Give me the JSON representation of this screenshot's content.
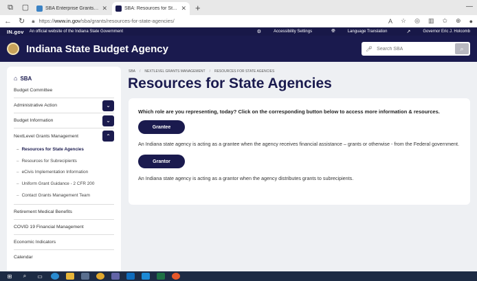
{
  "browser": {
    "tabs": [
      {
        "label": "SBA Enterprise Grants Managem",
        "active": false,
        "color": "#3b82c4"
      },
      {
        "label": "SBA: Resources for State Agencie",
        "active": true,
        "color": "#1a1a4e"
      }
    ],
    "url_prefix": "https://",
    "url_domain": "www.in.gov",
    "url_path": "/sba/grants/resources-for-state-agencies/"
  },
  "ingov": {
    "logo": "IN.gov",
    "official_text": "An official website of the Indiana State Government",
    "accessibility": "Accessibility Settings",
    "translation": "Language Translation",
    "governor": "Governor Eric J. Holcomb"
  },
  "header": {
    "title": "Indiana State Budget Agency",
    "search_placeholder": "Search SBA"
  },
  "sidebar": {
    "home": "SBA",
    "items": [
      {
        "label": "Budget Committee",
        "toggle": ""
      },
      {
        "label": "Administrative Action",
        "toggle": "⌄"
      },
      {
        "label": "Budget Information",
        "toggle": "⌄"
      },
      {
        "label": "NextLevel Grants Management",
        "toggle": "⌃"
      }
    ],
    "subitems": [
      {
        "label": "Resources for State Agencies",
        "active": true
      },
      {
        "label": "Resources for Subrecipients",
        "active": false
      },
      {
        "label": "eCivis Implementation Information",
        "active": false
      },
      {
        "label": "Uniform Grant Guidance - 2 CFR 200",
        "active": false
      },
      {
        "label": "Contact Grants Management Team",
        "active": false
      }
    ],
    "items_after": [
      {
        "label": "Retirement Medical Benefits"
      },
      {
        "label": "COVID 19 Financial Management"
      },
      {
        "label": "Economic Indicators"
      },
      {
        "label": "Calendar"
      }
    ]
  },
  "breadcrumb": [
    "SBA",
    "NEXTLEVEL GRANTS MANAGEMENT",
    "RESOURCES FOR STATE AGENCIES"
  ],
  "main": {
    "title": "Resources for State Agencies",
    "question": "Which role are you representing, today? Click on the corresponding button below to access more information & resources.",
    "grantee_label": "Grantee",
    "grantee_desc": "An Indiana state agency is acting as a grantee when the agency receives financial assistance – grants or otherwise - from the Federal government.",
    "grantor_label": "Grantor",
    "grantor_desc": "An Indiana state agency is acting as a grantor when the agency distributes grants to subrecipients."
  }
}
